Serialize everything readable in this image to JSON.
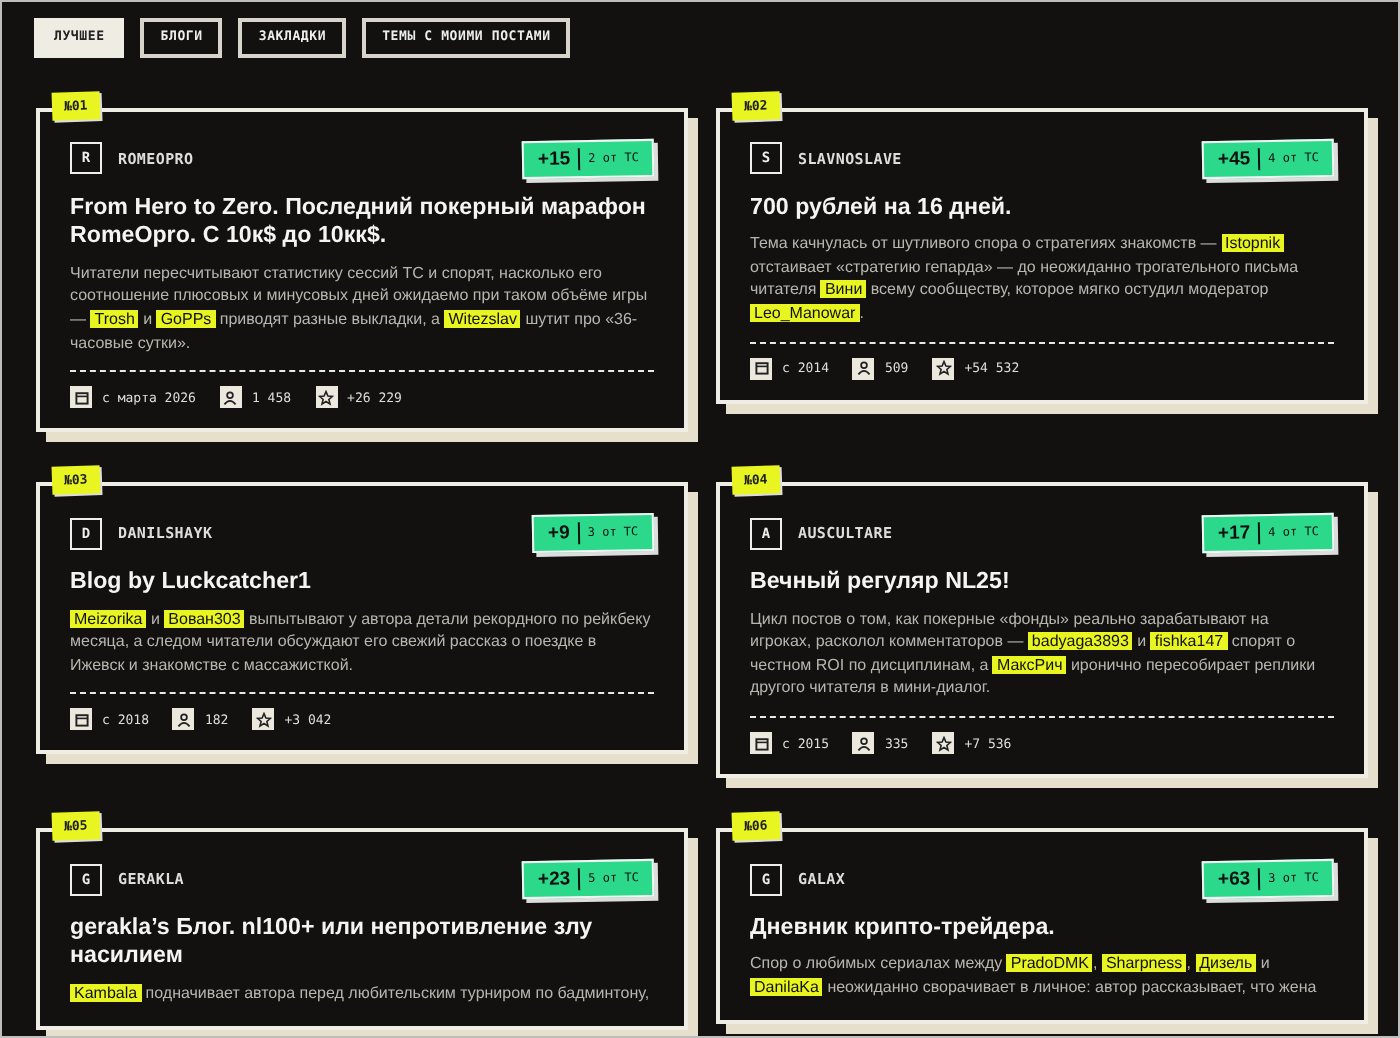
{
  "tabs": [
    {
      "label": "ЛУЧШЕЕ",
      "selected": true
    },
    {
      "label": "БЛОГИ",
      "selected": false
    },
    {
      "label": "ЗАКЛАДКИ",
      "selected": false
    },
    {
      "label": "ТЕМЫ С МОИМИ ПОСТАМИ",
      "selected": false
    }
  ],
  "posts": [
    {
      "rank": "№01",
      "avatar": "R",
      "author": "ROMEOPRO",
      "score": "+15",
      "score_note": "2 от ТС",
      "title": "From Hero to Zero. Последний покерный марафон RomeOpro. С 10к$ до 10кк$.",
      "description": [
        {
          "kind": "text",
          "text": "Читатели пересчитывают статистику сессий ТС и спорят, насколько его соотношение плюсовых и минусовых дней ожидаемо при таком объёме игры — "
        },
        {
          "kind": "mention",
          "text": "Trosh"
        },
        {
          "kind": "text",
          "text": " и "
        },
        {
          "kind": "mention",
          "text": "GoPPs"
        },
        {
          "kind": "text",
          "text": " приводят разные выкладки, а "
        },
        {
          "kind": "mention",
          "text": "Witezslav"
        },
        {
          "kind": "text",
          "text": " шутит про «36-часовые сутки»."
        }
      ],
      "since": "с марта 2026",
      "readers": "1 458",
      "rating": "+26 229"
    },
    {
      "rank": "№02",
      "avatar": "S",
      "author": "SLAVNOSLAVE",
      "score": "+45",
      "score_note": "4 от ТС",
      "title": "700 рублей на 16 дней.",
      "description": [
        {
          "kind": "text",
          "text": "Тема качнулась от шутливого спора о стратегиях знакомств — "
        },
        {
          "kind": "mention",
          "text": "Istopnik"
        },
        {
          "kind": "text",
          "text": " отстаивает «стратегию гепарда» — до неожиданно трогательного письма читателя "
        },
        {
          "kind": "mention",
          "text": "Вини"
        },
        {
          "kind": "text",
          "text": " всему сообществу, которое мягко остудил модератор "
        },
        {
          "kind": "mention",
          "text": "Leo_Manowar"
        },
        {
          "kind": "text",
          "text": "."
        }
      ],
      "since": "с 2014",
      "readers": "509",
      "rating": "+54 532"
    },
    {
      "rank": "№03",
      "avatar": "D",
      "author": "DANILSHAYK",
      "score": "+9",
      "score_note": "3 от ТС",
      "title": "Blog by Luckcatcher1",
      "description": [
        {
          "kind": "mention",
          "text": "Meizorika"
        },
        {
          "kind": "text",
          "text": " и "
        },
        {
          "kind": "mention",
          "text": "Вован303"
        },
        {
          "kind": "text",
          "text": " выпытывают у автора детали рекордного по рейкбеку месяца, а следом читатели обсуждают его свежий рассказ о поездке в Ижевск и знакомстве с массажисткой."
        }
      ],
      "since": "с 2018",
      "readers": "182",
      "rating": "+3 042"
    },
    {
      "rank": "№04",
      "avatar": "A",
      "author": "AUSCULTARE",
      "score": "+17",
      "score_note": "4 от ТС",
      "title": "Вечный регуляр NL25!",
      "description": [
        {
          "kind": "text",
          "text": "Цикл постов о том, как покерные «фонды» реально зарабатывают на игроках, расколол комментаторов — "
        },
        {
          "kind": "mention",
          "text": "badyaga3893"
        },
        {
          "kind": "text",
          "text": " и "
        },
        {
          "kind": "mention",
          "text": "fishka147"
        },
        {
          "kind": "text",
          "text": " спорят о честном ROI по дисциплинам, а "
        },
        {
          "kind": "mention",
          "text": "МаксРич"
        },
        {
          "kind": "text",
          "text": " иронично пересобирает реплики другого читателя в мини-диалог."
        }
      ],
      "since": "с 2015",
      "readers": "335",
      "rating": "+7 536"
    },
    {
      "rank": "№05",
      "avatar": "G",
      "author": "GERAKLA",
      "score": "+23",
      "score_note": "5 от ТС",
      "title": "gerakla’s Блог. nl100+ или непротивление злу насилием",
      "description": [
        {
          "kind": "mention",
          "text": "Kambala"
        },
        {
          "kind": "text",
          "text": " подначивает автора перед любительским турниром по бадминтону,"
        }
      ]
    },
    {
      "rank": "№06",
      "avatar": "G",
      "author": "GALAX",
      "score": "+63",
      "score_note": "3 от ТС",
      "title": "Дневник крипто-трейдера.",
      "description": [
        {
          "kind": "text",
          "text": "Спор о любимых сериалах между "
        },
        {
          "kind": "mention",
          "text": "PradoDMK"
        },
        {
          "kind": "text",
          "text": ", "
        },
        {
          "kind": "mention",
          "text": "Sharpness"
        },
        {
          "kind": "text",
          "text": ", "
        },
        {
          "kind": "mention",
          "text": "Дизель"
        },
        {
          "kind": "text",
          "text": " и "
        },
        {
          "kind": "mention",
          "text": "DanilaKa"
        },
        {
          "kind": "text",
          "text": " неожиданно сворачивает в личное: автор рассказывает, что жена"
        }
      ]
    }
  ]
}
